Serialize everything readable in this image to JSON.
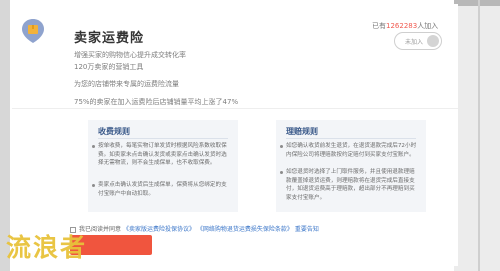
{
  "header": {
    "title": "卖家运费险",
    "descriptions": [
      "增强买家的购物信心提升成交转化率",
      "120万卖家的营销工具",
      "为您的店铺带来专属的运费险流量",
      "75%的卖家在加入运费险后店铺销量平均上涨了47%"
    ],
    "joined_prefix": "已有",
    "joined_count": "1262283",
    "joined_suffix": "人加入",
    "join_label": "未加入"
  },
  "collect_rules": {
    "title": "收费规则",
    "items": [
      "按单收费，每笔实物订单发货时根据风险系数收取保费。如卖家未点击确认发货或卖家点击确认发货时选择无需物流，则不会生成保单，也不收取保费。",
      "卖家点击确认发货后生成保单，保费将从您绑定的支付宝账户中自动扣取。"
    ]
  },
  "claim_rules": {
    "title": "理赔规则",
    "items": [
      "如您确认收货前发生退货，在退货退款完成后72小时内保险公司将理赔款按约定赔付到买家支付宝账户。",
      "如您退货时选择了上门取件服务，并且使用退款理赔款覆盖掉退货运费，则理赔款将在退货完成后直接支付，如退货运费高于理赔款，超出部分不再理赔到买家支付宝账户。"
    ]
  },
  "agreement": {
    "prefix": "我已阅读并同意",
    "link1": "《卖家版运费险投保协议》",
    "link2": "《网络购物退货运费损失保险条款》",
    "link3": "重要告知"
  },
  "watermark": "流浪者",
  "colors": {
    "accent": "#f0553e",
    "link": "#3c77c9",
    "rule_title": "#3b5a8a",
    "watermark": "#e8c23a"
  }
}
